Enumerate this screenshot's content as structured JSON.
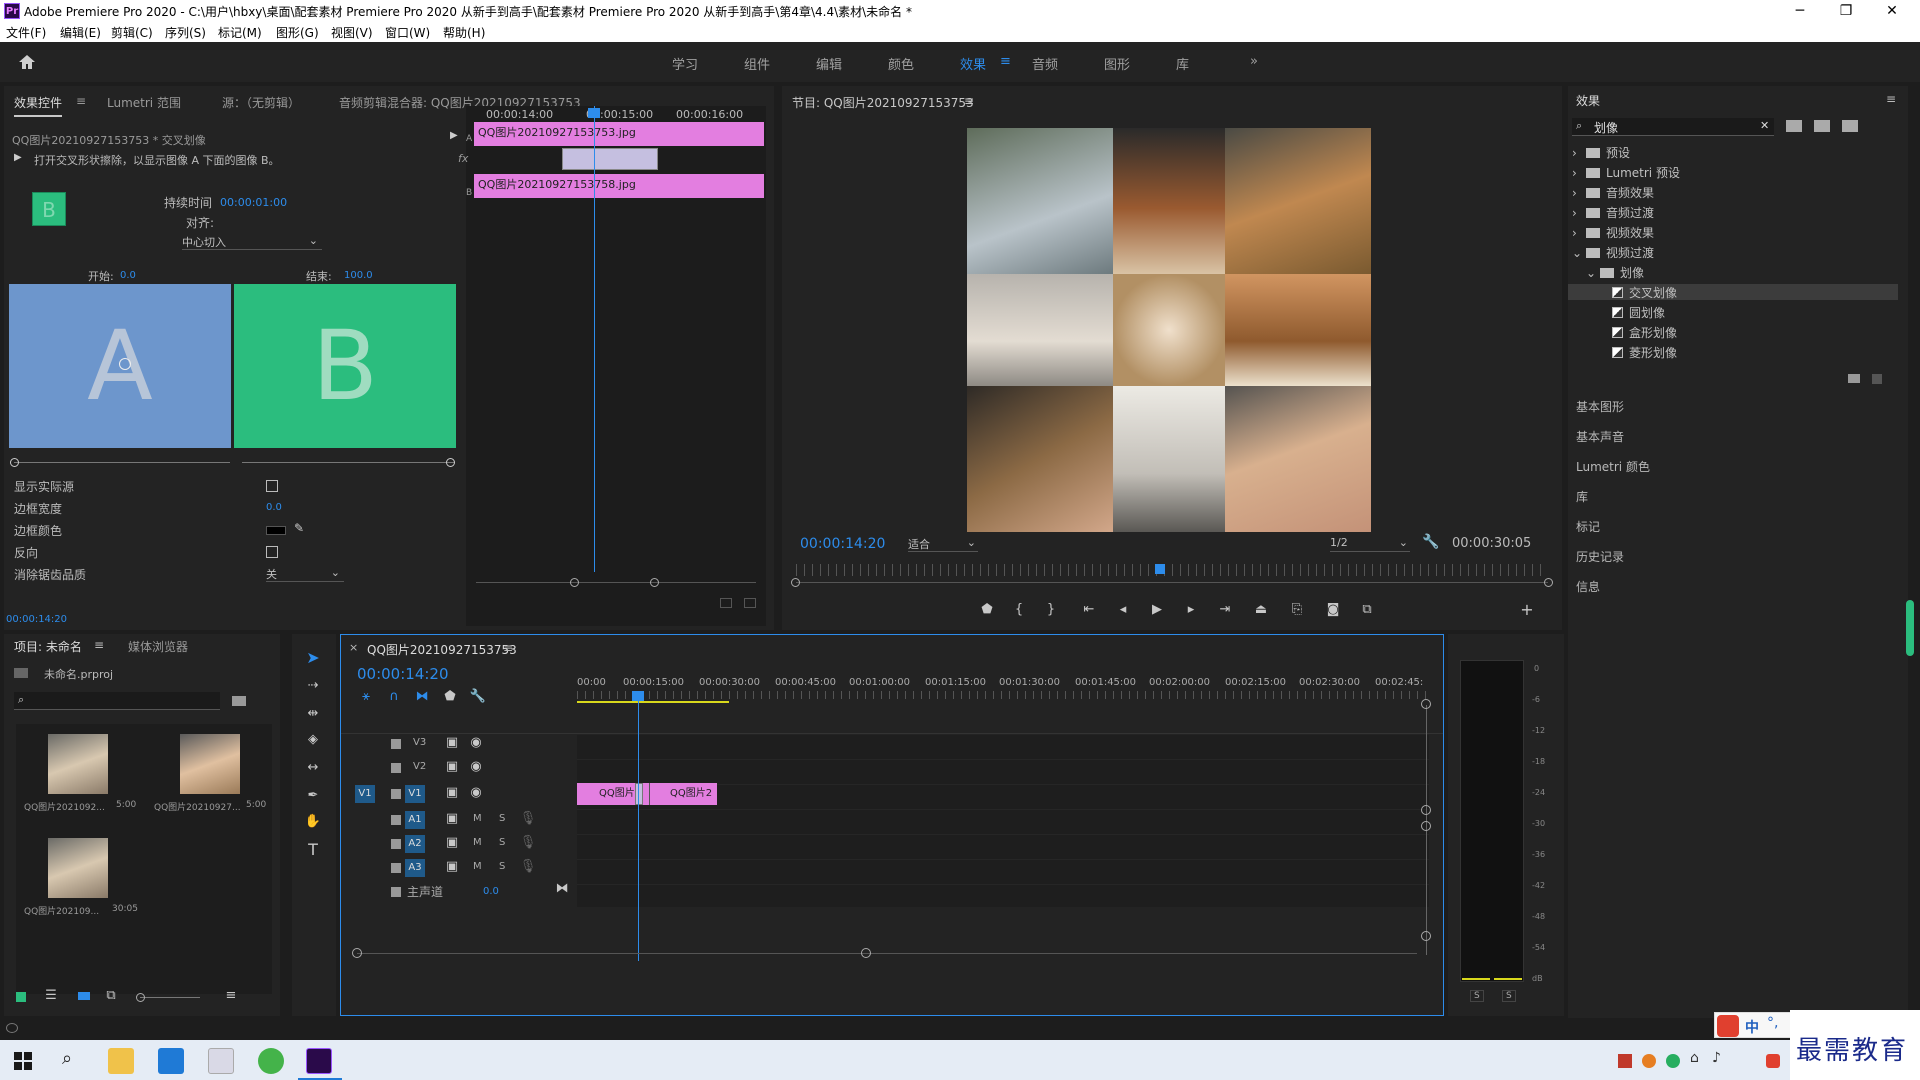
{
  "window": {
    "title": "Adobe Premiere Pro 2020 - C:\\用户\\hbxy\\桌面\\配套素材 Premiere Pro 2020 从新手到高手\\配套素材 Premiere Pro 2020 从新手到高手\\第4章\\4.4\\素材\\未命名 *",
    "logo": "Pr",
    "controls": [
      "─",
      "❐",
      "✕"
    ]
  },
  "menu": [
    "文件(F)",
    "编辑(E)",
    "剪辑(C)",
    "序列(S)",
    "标记(M)",
    "图形(G)",
    "视图(V)",
    "窗口(W)",
    "帮助(H)"
  ],
  "workspaces": {
    "items": [
      "学习",
      "组件",
      "编辑",
      "颜色",
      "效果",
      "音频",
      "图形",
      "库"
    ],
    "active": "效果",
    "more": "»"
  },
  "effect_controls": {
    "tabs": [
      "效果控件",
      "Lumetri 范围",
      "源：（无剪辑）",
      "音频剪辑混合器: QQ图片20210927153753"
    ],
    "clip_path": "QQ图片20210927153753 * 交叉划像",
    "description": "打开交叉形状擦除，以显示图像 A 下面的图像 B。",
    "preview_letter": "B",
    "duration_label": "持续时间",
    "duration_value": "00:00:01:00",
    "align_label": "对齐:",
    "align_value": "中心切入",
    "start_label": "开始:",
    "start_value": "0.0",
    "end_label": "结束:",
    "end_value": "100.0",
    "a_letter": "A",
    "b_letter": "B",
    "props": [
      {
        "label": "显示实际源",
        "kind": "checkbox"
      },
      {
        "label": "边框宽度",
        "value": "0.0"
      },
      {
        "label": "边框颜色",
        "kind": "color"
      },
      {
        "label": "反向",
        "kind": "checkbox"
      },
      {
        "label": "消除锯齿品质",
        "value": "关"
      }
    ],
    "timecode": "00:00:14:20",
    "mini_timeline": {
      "ticks": [
        "00:00:14:00",
        "00:00:15:00",
        "00:00:16:00"
      ],
      "clip_a": "QQ图片20210927153753.jpg",
      "clip_b": "QQ图片20210927153758.jpg",
      "fx": "fx",
      "a": "A",
      "b": "B"
    }
  },
  "program_monitor": {
    "title": "节目: QQ图片20210927153753",
    "timecode": "00:00:14:20",
    "fit": "适合",
    "resolution": "1/2",
    "duration": "00:00:30:05"
  },
  "effects_panel": {
    "title": "效果",
    "search_value": "划像",
    "tree": [
      {
        "label": "预设",
        "level": 0,
        "exp": "›"
      },
      {
        "label": "Lumetri 预设",
        "level": 0,
        "exp": "›"
      },
      {
        "label": "音频效果",
        "level": 0,
        "exp": "›"
      },
      {
        "label": "音频过渡",
        "level": 0,
        "exp": "›"
      },
      {
        "label": "视频效果",
        "level": 0,
        "exp": "›"
      },
      {
        "label": "视频过渡",
        "level": 0,
        "exp": "⌄"
      },
      {
        "label": "划像",
        "level": 1,
        "exp": "⌄"
      },
      {
        "label": "交叉划像",
        "level": 2,
        "selected": true
      },
      {
        "label": "圆划像",
        "level": 2
      },
      {
        "label": "盒形划像",
        "level": 2
      },
      {
        "label": "菱形划像",
        "level": 2
      }
    ],
    "sections": [
      "基本图形",
      "基本声音",
      "Lumetri 颜色",
      "库",
      "标记",
      "历史记录",
      "信息"
    ]
  },
  "project": {
    "tabs": [
      "项目: 未命名",
      "媒体浏览器"
    ],
    "file": "未命名.prproj",
    "items": [
      {
        "name": "QQ图片2021092...",
        "dur": "5:00"
      },
      {
        "name": "QQ图片20210927...",
        "dur": "5:00"
      },
      {
        "name": "QQ图片202109...",
        "dur": "30:05"
      }
    ]
  },
  "timeline": {
    "tab": "QQ图片20210927153753",
    "close": "×",
    "timecode": "00:00:14:20",
    "ruler": [
      "00:00",
      "00:00:15:00",
      "00:00:30:00",
      "00:00:45:00",
      "00:01:00:00",
      "00:01:15:00",
      "00:01:30:00",
      "00:01:45:00",
      "00:02:00:00",
      "00:02:15:00",
      "00:02:30:00",
      "00:02:45:"
    ],
    "video_tracks": [
      "V3",
      "V2",
      "V1"
    ],
    "audio_tracks": [
      "A1",
      "A2",
      "A3"
    ],
    "source_patch": "V1",
    "master": "主声道",
    "master_value": "0.0",
    "clip1": "QQ图片",
    "clip2": "QQ图片2",
    "m": "M",
    "s": "S"
  },
  "meter": {
    "scale": [
      "0",
      "-6",
      "-12",
      "-18",
      "-24",
      "-30",
      "-36",
      "-42",
      "-48",
      "-54",
      "dB"
    ],
    "solo": [
      "S",
      "S"
    ]
  },
  "watermark": "最需教育",
  "ime": "中",
  "colors": {
    "accent": "#2d8ceb",
    "clip": "#e37ee0",
    "panel": "#232323",
    "bg": "#1d1d1d"
  }
}
